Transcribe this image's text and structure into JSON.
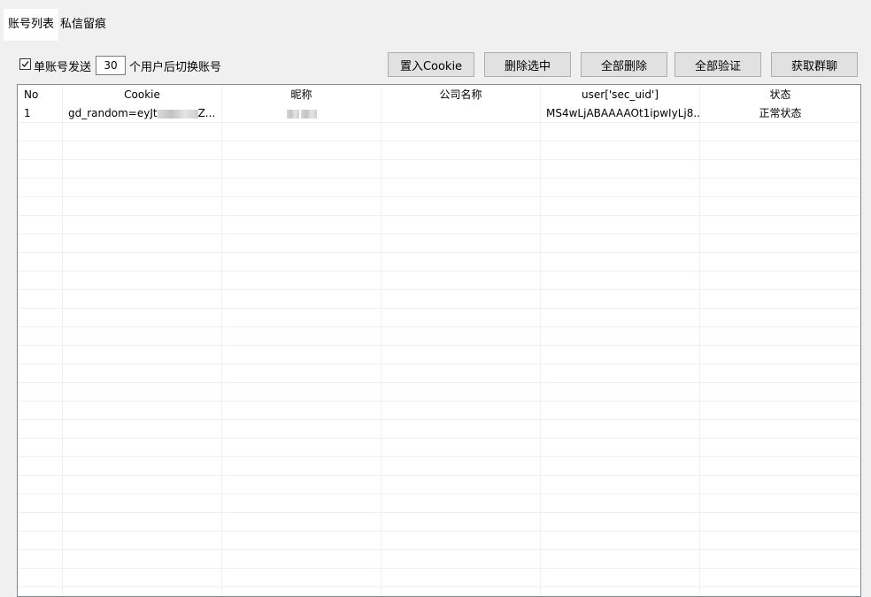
{
  "tabs": [
    {
      "label": "账号列表",
      "active": true
    },
    {
      "label": "私信留痕",
      "active": false
    }
  ],
  "controls": {
    "single_account_send_label": "单账号发送",
    "single_account_send_checked": true,
    "switch_count": "30",
    "switch_after_label": "个用户后切换账号"
  },
  "toolbar": {
    "import_cookie": "置入Cookie",
    "delete_selected": "删除选中",
    "delete_all": "全部删除",
    "verify_all": "全部验证",
    "fetch_group_chat": "获取群聊"
  },
  "table": {
    "columns": [
      "No",
      "Cookie",
      "昵称",
      "公司名称",
      "user['sec_uid']",
      "状态"
    ],
    "rows": [
      {
        "no": "1",
        "cookie_prefix": "gd_random=eyJt",
        "cookie_suffix": "Z...",
        "nickname": "",
        "company": "",
        "sec_uid": "MS4wLjABAAAAOt1ipwIyLj8...",
        "status": "正常状态"
      }
    ]
  },
  "colors": {
    "window_bg": "#f0f0f0",
    "button_bg": "#e1e1e1",
    "grid_border": "#828790",
    "grid_line": "#f0f0f0"
  }
}
